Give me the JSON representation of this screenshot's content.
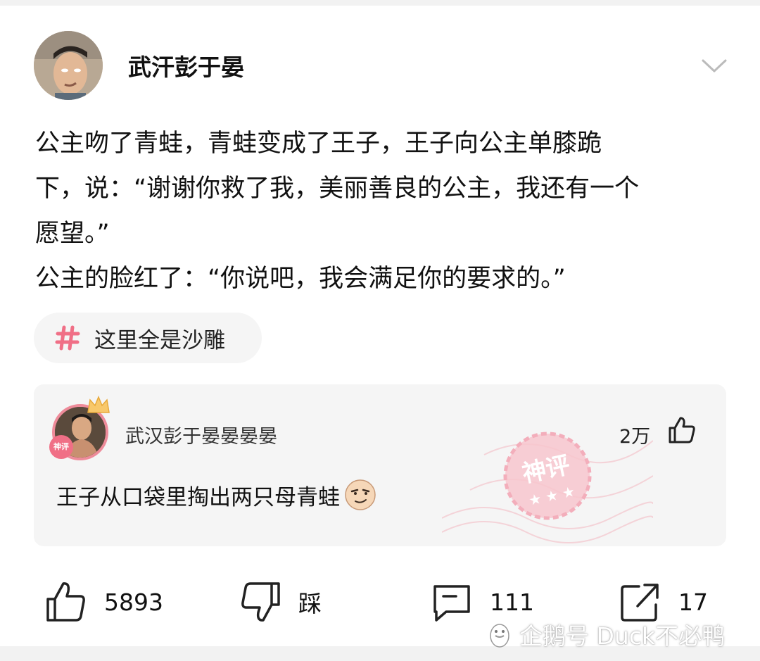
{
  "post": {
    "author": "武汗彭于晏",
    "lines": [
      "公主吻了青蛙，青蛙变成了王子，王子向公主单膝跪",
      "下，说：“谢谢你救了我，美丽善良的公主，我还有一个",
      "愿望。”",
      "公主的脸红了：“你说吧，我会满足你的要求的。”"
    ],
    "tag": "这里全是沙雕"
  },
  "top_comment": {
    "author": "武汉彭于晏晏晏晏",
    "likes": "2万",
    "text": "王子从口袋里掏出两只母青蛙",
    "badge": "神评"
  },
  "actions": {
    "like_count": "5893",
    "dislike_label": "踩",
    "comment_count": "111",
    "share_count": "17"
  },
  "watermark": "企鹅号 Duck不必鸭",
  "colors": {
    "accent_pink": "#f06f86",
    "background": "#ffffff"
  }
}
